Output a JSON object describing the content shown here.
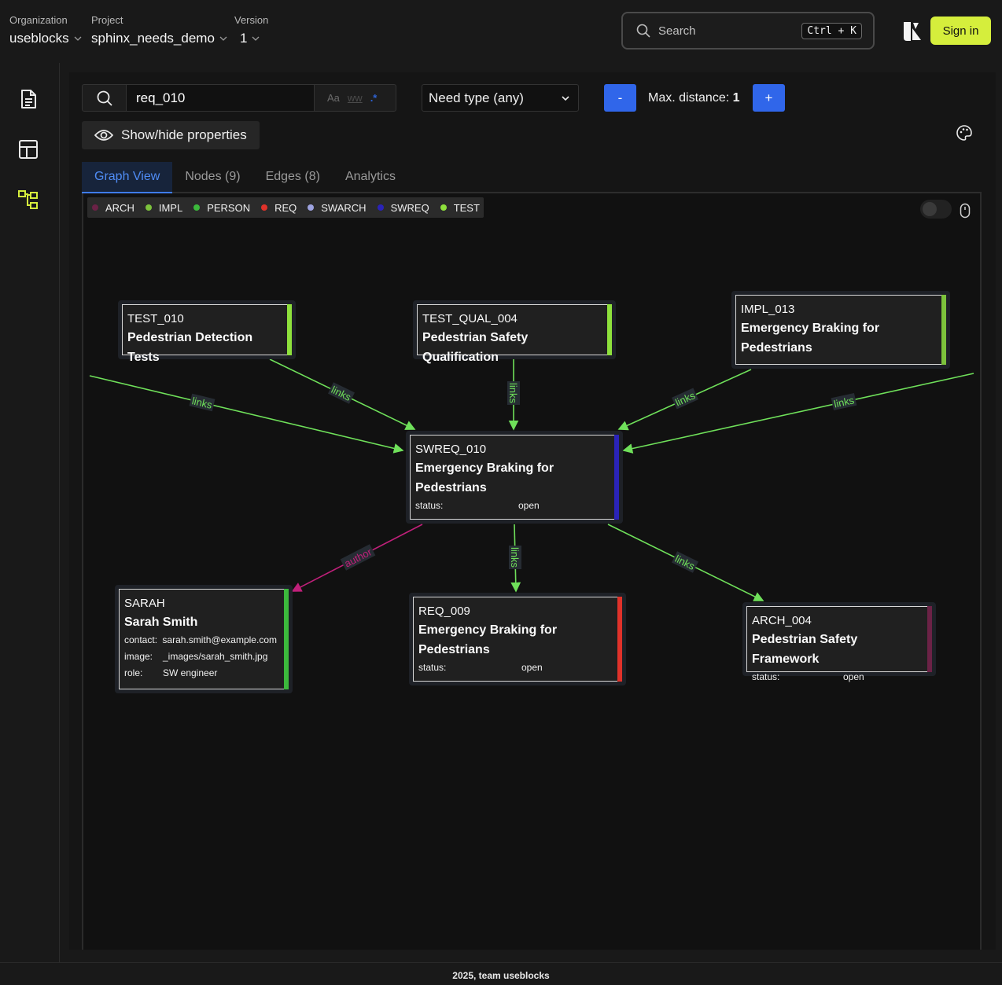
{
  "header": {
    "organization": {
      "label": "Organization",
      "value": "useblocks"
    },
    "project": {
      "label": "Project",
      "value": "sphinx_needs_demo"
    },
    "version": {
      "label": "Version",
      "value": "1"
    },
    "search": {
      "placeholder": "Search",
      "shortcut": "Ctrl + K"
    },
    "signin_label": "Sign in",
    "accent_color": "#d5ee3c"
  },
  "sidebar": {
    "items": [
      {
        "icon": "document-icon"
      },
      {
        "icon": "layout-icon"
      },
      {
        "icon": "graph-icon",
        "active": true
      }
    ]
  },
  "toolbar": {
    "query_value": "req_010",
    "match_case": "Aa",
    "whole_word": "ww",
    "regex": ".*",
    "need_type": "Need type (any)",
    "minus_label": "-",
    "plus_label": "+",
    "max_distance_label": "Max. distance:",
    "max_distance_value": "1",
    "show_hide_label": "Show/hide properties"
  },
  "tabs": [
    {
      "label": "Graph View",
      "active": true
    },
    {
      "label": "Nodes (9)"
    },
    {
      "label": "Edges (8)"
    },
    {
      "label": "Analytics"
    }
  ],
  "legend": [
    {
      "label": "ARCH",
      "color": "#6b2246"
    },
    {
      "label": "IMPL",
      "color": "#7cc23c"
    },
    {
      "label": "PERSON",
      "color": "#3cb93c"
    },
    {
      "label": "REQ",
      "color": "#e0322a"
    },
    {
      "label": "SWARCH",
      "color": "#9ea3e0"
    },
    {
      "label": "SWREQ",
      "color": "#2a23b8"
    },
    {
      "label": "TEST",
      "color": "#8ee03c"
    }
  ],
  "nodes": {
    "test_010": {
      "id": "TEST_010",
      "title": "Pedestrian Detection Tests",
      "color": "#8ee03c"
    },
    "test_qual_004": {
      "id": "TEST_QUAL_004",
      "title": "Pedestrian Safety Qualification",
      "color": "#8ee03c"
    },
    "impl_013": {
      "id": "IMPL_013",
      "title": "Emergency Braking for Pedestrians",
      "color": "#7cc23c"
    },
    "swreq_010": {
      "id": "SWREQ_010",
      "title": "Emergency Braking for Pedestrians",
      "color": "#2a23b8",
      "props": [
        {
          "key": "status:",
          "value": "open"
        }
      ]
    },
    "sarah": {
      "id": "SARAH",
      "title": "Sarah Smith",
      "color": "#3cb93c",
      "props": [
        {
          "key": "contact:",
          "value": "sarah.smith@example.com"
        },
        {
          "key": "image:",
          "value": "_images/sarah_smith.jpg"
        },
        {
          "key": "role:",
          "value": "SW engineer"
        }
      ]
    },
    "req_009": {
      "id": "REQ_009",
      "title": "Emergency Braking for Pedestrians",
      "color": "#e0322a",
      "props": [
        {
          "key": "status:",
          "value": "open"
        }
      ]
    },
    "arch_004": {
      "id": "ARCH_004",
      "title": "Pedestrian Safety Framework",
      "color": "#6b2246",
      "props": [
        {
          "key": "status:",
          "value": "open"
        }
      ]
    }
  },
  "edges": [
    {
      "label": "links",
      "color": "#6fe05a"
    },
    {
      "label": "links",
      "color": "#6fe05a"
    },
    {
      "label": "links",
      "color": "#6fe05a"
    },
    {
      "label": "links",
      "color": "#6fe05a"
    },
    {
      "label": "links",
      "color": "#6fe05a"
    },
    {
      "label": "author",
      "color": "#c0207a"
    },
    {
      "label": "links",
      "color": "#6fe05a"
    },
    {
      "label": "links",
      "color": "#6fe05a"
    }
  ],
  "footer": "2025, team useblocks"
}
